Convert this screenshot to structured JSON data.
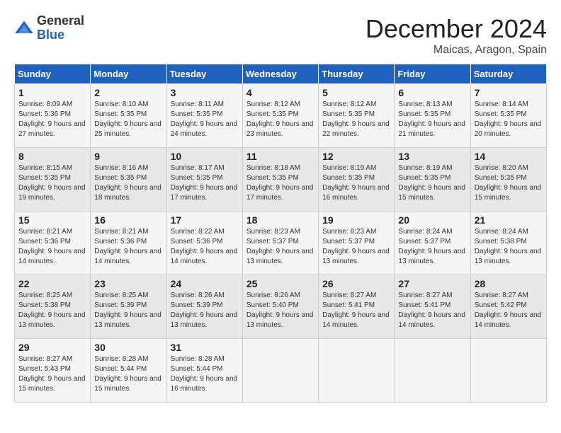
{
  "header": {
    "logo_general": "General",
    "logo_blue": "Blue",
    "month_title": "December 2024",
    "location": "Maicas, Aragon, Spain"
  },
  "days_of_week": [
    "Sunday",
    "Monday",
    "Tuesday",
    "Wednesday",
    "Thursday",
    "Friday",
    "Saturday"
  ],
  "weeks": [
    [
      {
        "day": "1",
        "sunrise": "8:09 AM",
        "sunset": "5:36 PM",
        "daylight": "9 hours and 27 minutes."
      },
      {
        "day": "2",
        "sunrise": "8:10 AM",
        "sunset": "5:35 PM",
        "daylight": "9 hours and 25 minutes."
      },
      {
        "day": "3",
        "sunrise": "8:11 AM",
        "sunset": "5:35 PM",
        "daylight": "9 hours and 24 minutes."
      },
      {
        "day": "4",
        "sunrise": "8:12 AM",
        "sunset": "5:35 PM",
        "daylight": "9 hours and 23 minutes."
      },
      {
        "day": "5",
        "sunrise": "8:12 AM",
        "sunset": "5:35 PM",
        "daylight": "9 hours and 22 minutes."
      },
      {
        "day": "6",
        "sunrise": "8:13 AM",
        "sunset": "5:35 PM",
        "daylight": "9 hours and 21 minutes."
      },
      {
        "day": "7",
        "sunrise": "8:14 AM",
        "sunset": "5:35 PM",
        "daylight": "9 hours and 20 minutes."
      }
    ],
    [
      {
        "day": "8",
        "sunrise": "8:15 AM",
        "sunset": "5:35 PM",
        "daylight": "9 hours and 19 minutes."
      },
      {
        "day": "9",
        "sunrise": "8:16 AM",
        "sunset": "5:35 PM",
        "daylight": "9 hours and 18 minutes."
      },
      {
        "day": "10",
        "sunrise": "8:17 AM",
        "sunset": "5:35 PM",
        "daylight": "9 hours and 17 minutes."
      },
      {
        "day": "11",
        "sunrise": "8:18 AM",
        "sunset": "5:35 PM",
        "daylight": "9 hours and 17 minutes."
      },
      {
        "day": "12",
        "sunrise": "8:19 AM",
        "sunset": "5:35 PM",
        "daylight": "9 hours and 16 minutes."
      },
      {
        "day": "13",
        "sunrise": "8:19 AM",
        "sunset": "5:35 PM",
        "daylight": "9 hours and 15 minutes."
      },
      {
        "day": "14",
        "sunrise": "8:20 AM",
        "sunset": "5:35 PM",
        "daylight": "9 hours and 15 minutes."
      }
    ],
    [
      {
        "day": "15",
        "sunrise": "8:21 AM",
        "sunset": "5:36 PM",
        "daylight": "9 hours and 14 minutes."
      },
      {
        "day": "16",
        "sunrise": "8:21 AM",
        "sunset": "5:36 PM",
        "daylight": "9 hours and 14 minutes."
      },
      {
        "day": "17",
        "sunrise": "8:22 AM",
        "sunset": "5:36 PM",
        "daylight": "9 hours and 14 minutes."
      },
      {
        "day": "18",
        "sunrise": "8:23 AM",
        "sunset": "5:37 PM",
        "daylight": "9 hours and 13 minutes."
      },
      {
        "day": "19",
        "sunrise": "8:23 AM",
        "sunset": "5:37 PM",
        "daylight": "9 hours and 13 minutes."
      },
      {
        "day": "20",
        "sunrise": "8:24 AM",
        "sunset": "5:37 PM",
        "daylight": "9 hours and 13 minutes."
      },
      {
        "day": "21",
        "sunrise": "8:24 AM",
        "sunset": "5:38 PM",
        "daylight": "9 hours and 13 minutes."
      }
    ],
    [
      {
        "day": "22",
        "sunrise": "8:25 AM",
        "sunset": "5:38 PM",
        "daylight": "9 hours and 13 minutes."
      },
      {
        "day": "23",
        "sunrise": "8:25 AM",
        "sunset": "5:39 PM",
        "daylight": "9 hours and 13 minutes."
      },
      {
        "day": "24",
        "sunrise": "8:26 AM",
        "sunset": "5:39 PM",
        "daylight": "9 hours and 13 minutes."
      },
      {
        "day": "25",
        "sunrise": "8:26 AM",
        "sunset": "5:40 PM",
        "daylight": "9 hours and 13 minutes."
      },
      {
        "day": "26",
        "sunrise": "8:27 AM",
        "sunset": "5:41 PM",
        "daylight": "9 hours and 14 minutes."
      },
      {
        "day": "27",
        "sunrise": "8:27 AM",
        "sunset": "5:41 PM",
        "daylight": "9 hours and 14 minutes."
      },
      {
        "day": "28",
        "sunrise": "8:27 AM",
        "sunset": "5:42 PM",
        "daylight": "9 hours and 14 minutes."
      }
    ],
    [
      {
        "day": "29",
        "sunrise": "8:27 AM",
        "sunset": "5:43 PM",
        "daylight": "9 hours and 15 minutes."
      },
      {
        "day": "30",
        "sunrise": "8:28 AM",
        "sunset": "5:44 PM",
        "daylight": "9 hours and 15 minutes."
      },
      {
        "day": "31",
        "sunrise": "8:28 AM",
        "sunset": "5:44 PM",
        "daylight": "9 hours and 16 minutes."
      },
      null,
      null,
      null,
      null
    ]
  ]
}
